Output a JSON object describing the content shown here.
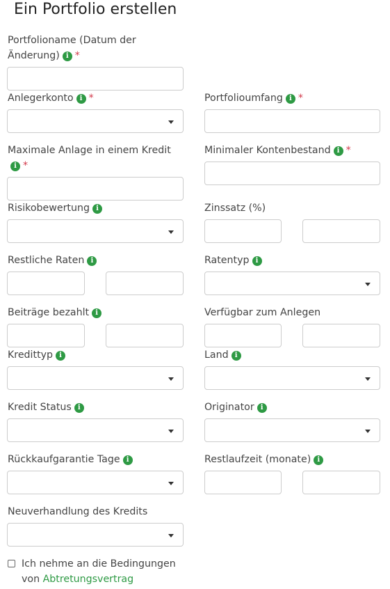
{
  "title": "Ein Portfolio erstellen",
  "info_glyph": "i",
  "required_mark": "*",
  "fields": {
    "portfolio_name": "Portfolioname (Datum der Änderung)",
    "investor_account": "Anlegerkonto",
    "portfolio_size": "Portfolioumfang",
    "max_investment": "Maximale Anlage in einem Kredit",
    "min_balance": "Minimaler Kontenbestand",
    "risk_rating": "Risikobewertung",
    "interest_rate": "Zinssatz (%)",
    "remaining_installments": "Restliche Raten",
    "installment_type": "Ratentyp",
    "contributions_paid": "Beiträge bezahlt",
    "available_to_invest": "Verfügbar zum Anlegen",
    "loan_type": "Kredittyp",
    "country": "Land",
    "loan_status": "Kredit Status",
    "originator": "Originator",
    "buyback_days": "Rückkaufgarantie Tage",
    "remaining_term": "Restlaufzeit (monate)",
    "renegotiation": "Neuverhandlung des Kredits"
  },
  "terms": {
    "line1": "Ich nehme an die Bedingungen",
    "line2_prefix": "von",
    "link": "Abtretungsvertrag"
  },
  "colors": {
    "info": "#2e9a44",
    "required": "#d2394a",
    "link": "#2e9a44"
  }
}
